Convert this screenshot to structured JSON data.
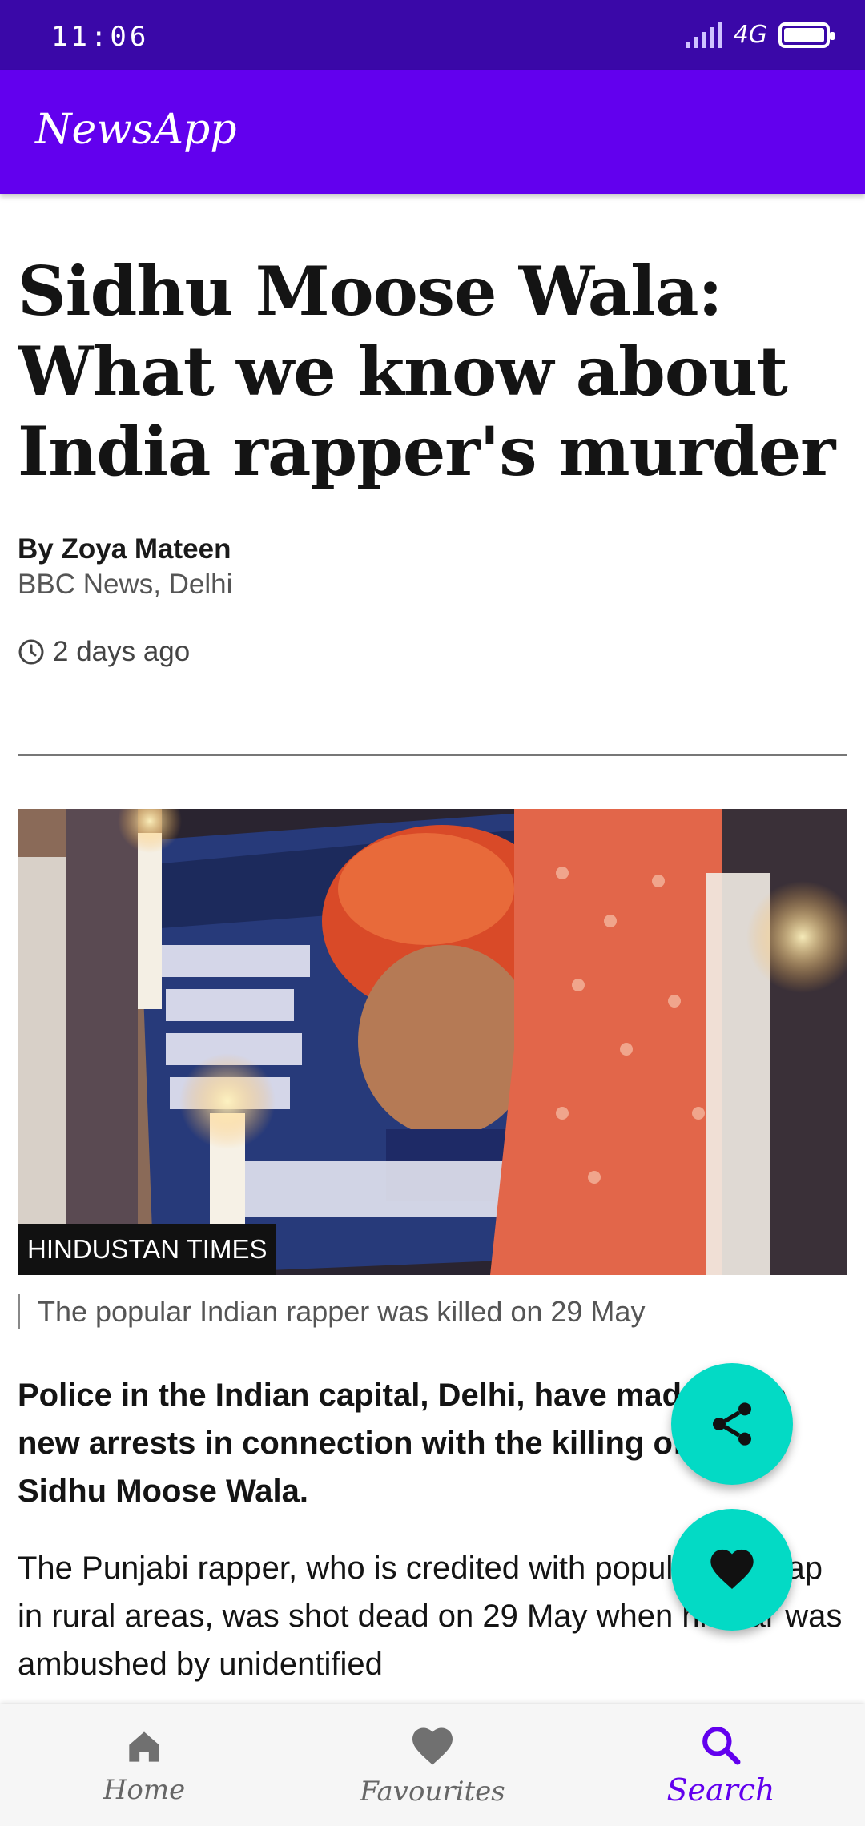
{
  "status_bar": {
    "time": "11:06",
    "network": "4G"
  },
  "app_bar": {
    "title": "NewsApp"
  },
  "article": {
    "headline": "Sidhu Moose Wala: What we know about India rapper's murder",
    "author": "By Zoya Mateen",
    "source": "BBC News, Delhi",
    "published": "2 days ago",
    "image": {
      "credit": "HINDUSTAN TIMES",
      "caption": "The popular Indian rapper was killed on 29 May"
    },
    "lead": "Police in the Indian capital, Delhi, have made three new arrests in connection with the killing of singer Sidhu Moose Wala.",
    "body": "The Punjabi rapper, who is credited with popularising rap in rural areas, was shot dead on 29 May when his car was ambushed by unidentified"
  },
  "bottom_nav": {
    "items": [
      {
        "label": "Home",
        "icon": "home-icon",
        "active": false
      },
      {
        "label": "Favourites",
        "icon": "heart-icon",
        "active": false
      },
      {
        "label": "Search",
        "icon": "search-icon",
        "active": true
      }
    ]
  },
  "colors": {
    "status_bar": "#3a08a8",
    "app_bar": "#6200ee",
    "fab": "#03dac5",
    "active_nav": "#6200ee"
  }
}
